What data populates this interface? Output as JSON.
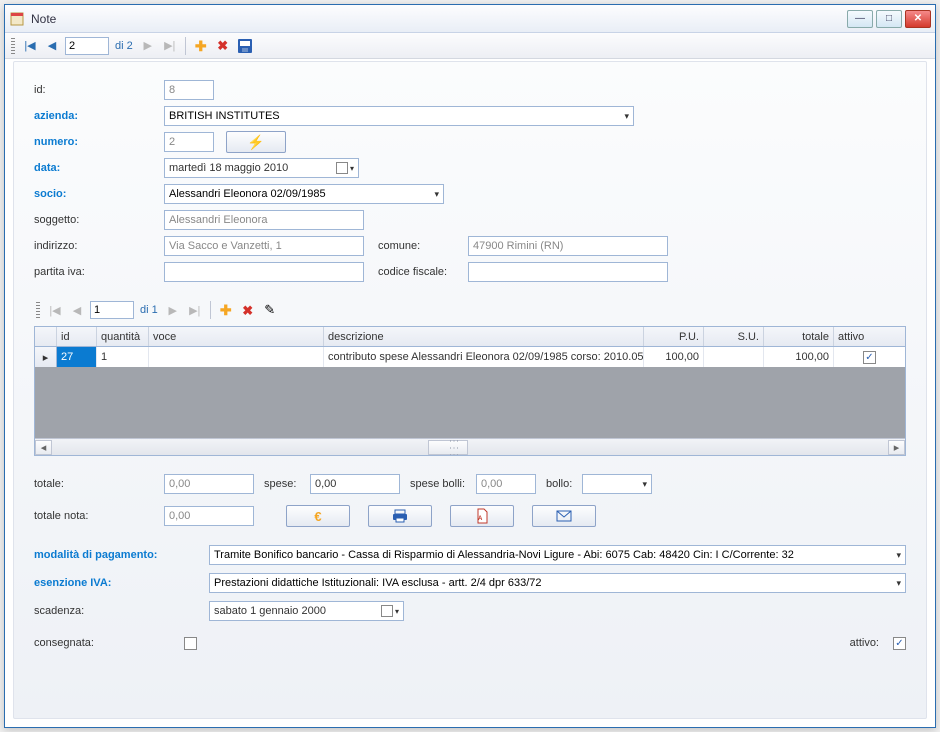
{
  "window": {
    "title": "Note"
  },
  "nav1": {
    "pos": "2",
    "of_label": "di 2"
  },
  "fields": {
    "id_label": "id:",
    "id": "8",
    "azienda_label": "azienda:",
    "azienda": "BRITISH INSTITUTES",
    "numero_label": "numero:",
    "numero": "2",
    "data_label": "data:",
    "data": "martedì   18   maggio   2010",
    "socio_label": "socio:",
    "socio": "Alessandri Eleonora 02/09/1985",
    "soggetto_label": "soggetto:",
    "soggetto": "Alessandri Eleonora",
    "indirizzo_label": "indirizzo:",
    "indirizzo": "Via Sacco e Vanzetti, 1",
    "comune_label": "comune:",
    "comune": "47900 Rimini (RN)",
    "partita_iva_label": "partita iva:",
    "partita_iva": "",
    "codice_fiscale_label": "codice fiscale:",
    "codice_fiscale": ""
  },
  "nav2": {
    "pos": "1",
    "of_label": "di 1"
  },
  "grid": {
    "headers": {
      "id": "id",
      "quantita": "quantità",
      "voce": "voce",
      "descrizione": "descrizione",
      "pu": "P.U.",
      "su": "S.U.",
      "totale": "totale",
      "attivo": "attivo"
    },
    "row": {
      "id": "27",
      "quantita": "1",
      "voce": "",
      "descrizione": "contributo spese Alessandri Eleonora 02/09/1985 corso: 2010.05...",
      "pu": "100,00",
      "su": "",
      "totale": "100,00",
      "attivo": "✓"
    }
  },
  "totals": {
    "totale_label": "totale:",
    "totale": "0,00",
    "spese_label": "spese:",
    "spese": "0,00",
    "spese_bolli_label": "spese bolli:",
    "spese_bolli": "0,00",
    "bollo_label": "bollo:",
    "bollo": "",
    "totale_nota_label": "totale nota:",
    "totale_nota": "0,00"
  },
  "payment": {
    "modalita_label": "modalità di pagamento:",
    "modalita": "Tramite Bonifico bancario - Cassa di Risparmio di Alessandria-Novi Ligure - Abi: 6075 Cab: 48420 Cin: I C/Corrente: 32",
    "esenzione_label": "esenzione IVA:",
    "esenzione": "Prestazioni didattiche Istituzionali: IVA esclusa - artt. 2/4 dpr 633/72",
    "scadenza_label": "scadenza:",
    "scadenza": "sabato    1   gennaio    2000",
    "consegnata_label": "consegnata:",
    "attivo_label": "attivo:",
    "attivo_check": "✓"
  },
  "icons": {
    "euro": "€",
    "pdf": "↓",
    "lightning": "⚡"
  }
}
